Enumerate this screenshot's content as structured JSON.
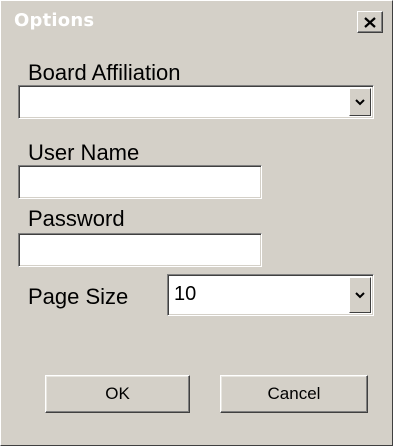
{
  "window": {
    "title": "Options"
  },
  "form": {
    "board_affiliation": {
      "label": "Board Affiliation",
      "value": ""
    },
    "user_name": {
      "label": "User Name",
      "value": ""
    },
    "password": {
      "label": "Password",
      "value": ""
    },
    "page_size": {
      "label": "Page Size",
      "value": "10"
    }
  },
  "buttons": {
    "ok_label": "OK",
    "cancel_label": "Cancel"
  },
  "icons": {
    "close": "close-icon",
    "dropdown": "chevron-down-icon"
  }
}
